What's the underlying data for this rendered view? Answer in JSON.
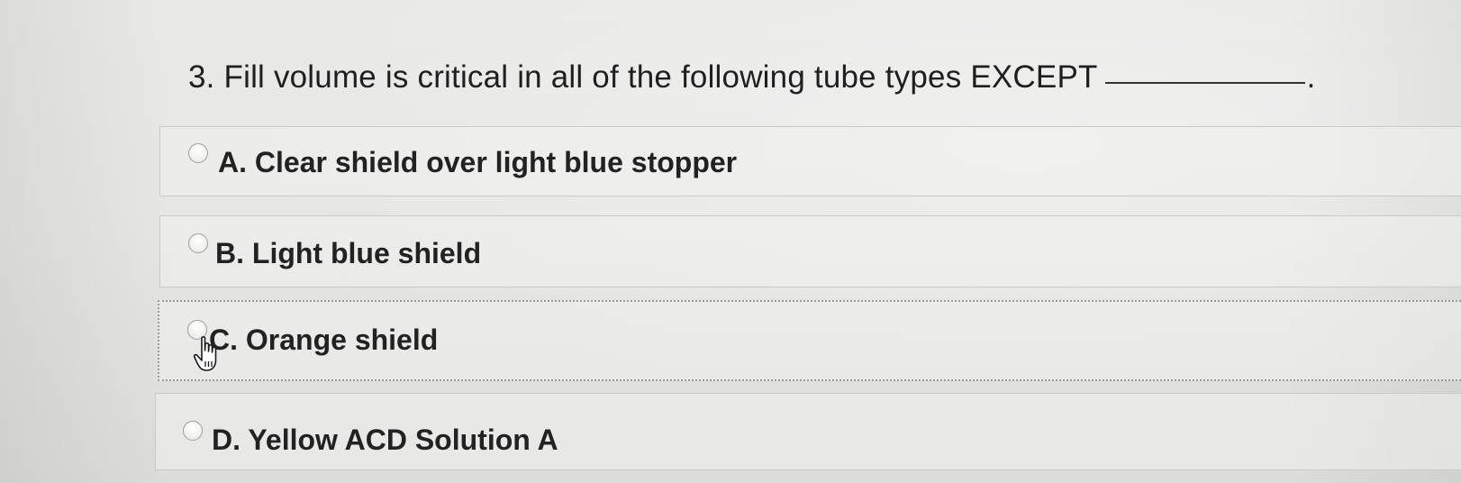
{
  "question": {
    "text": "3. Fill volume is critical in all of the following tube types EXCEPT",
    "period": "."
  },
  "options": [
    {
      "id": "A",
      "label": "A. Clear shield over light blue stopper",
      "selected": false
    },
    {
      "id": "B",
      "label": "B. Light blue shield",
      "selected": false
    },
    {
      "id": "C",
      "label": "C. Orange shield",
      "selected": false
    },
    {
      "id": "D",
      "label": "D. Yellow ACD Solution A",
      "selected": false
    }
  ],
  "cursor": {
    "icon": "hand-pointer-icon"
  }
}
